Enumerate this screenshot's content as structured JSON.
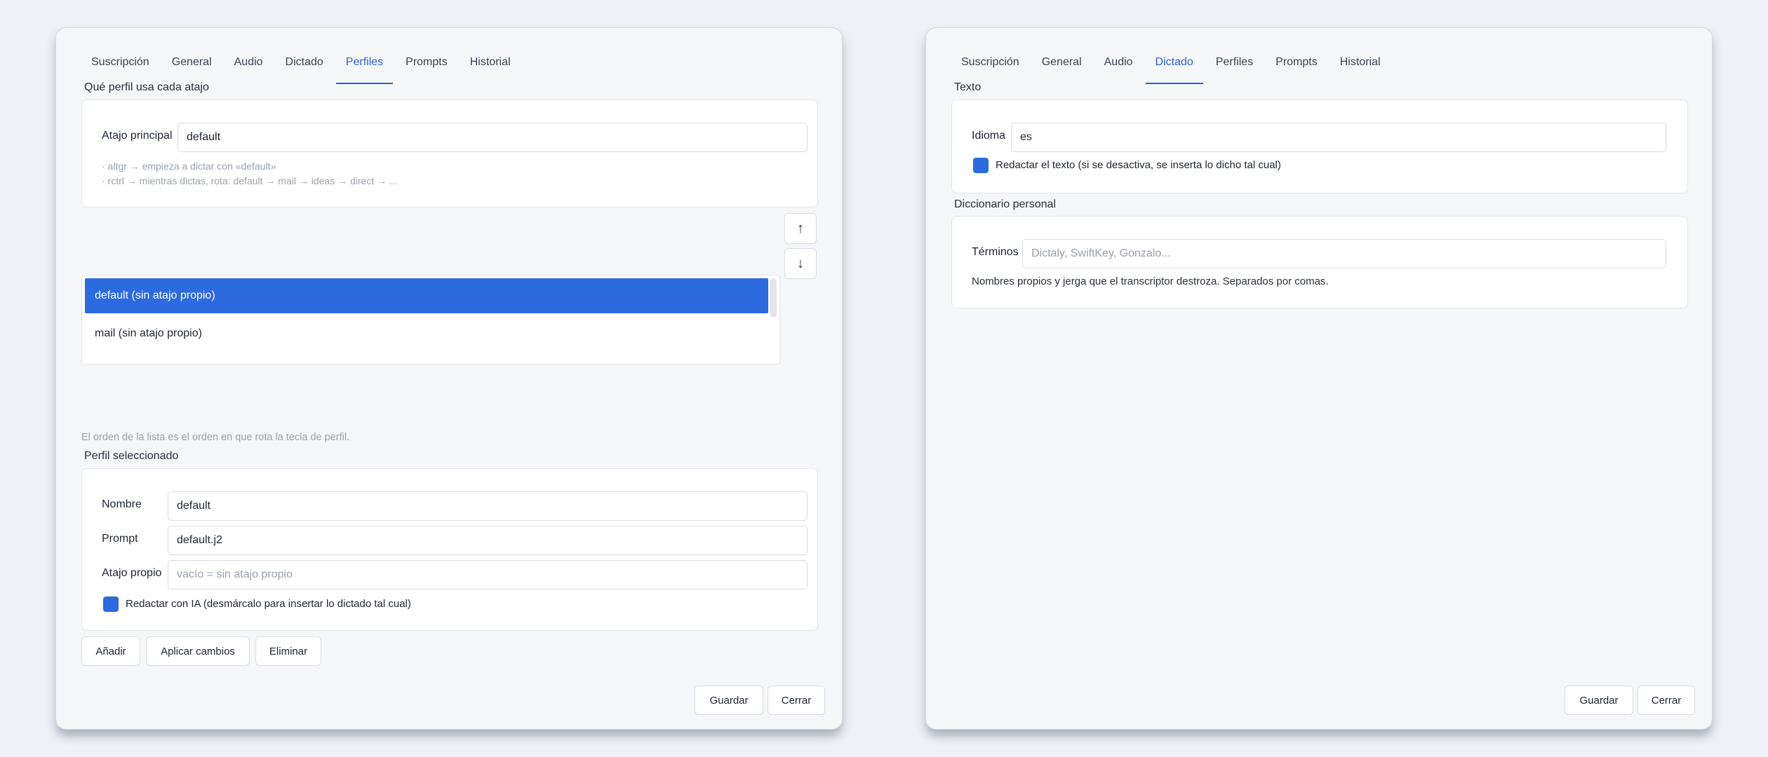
{
  "tabs": [
    "Suscripción",
    "General",
    "Audio",
    "Dictado",
    "Perfiles",
    "Prompts",
    "Historial"
  ],
  "left": {
    "active_tab": "Perfiles",
    "shortcut_section": {
      "title": "Qué perfil usa cada atajo",
      "main_shortcut_label": "Atajo principal",
      "main_shortcut_value": "default",
      "hint_lines": [
        "· altgr → empieza a dictar con «default»",
        "· rctrl → mientras dictas, rota: default → mail → ideas → direct → ..."
      ]
    },
    "move_up_icon": "↑",
    "move_down_icon": "↓",
    "profile_list": [
      {
        "label": "default  (sin atajo propio)",
        "selected": true
      },
      {
        "label": "mail  (sin atajo propio)",
        "selected": false
      }
    ],
    "order_hint": "El orden de la lista es el orden en que rota la tecla de perfil.",
    "selected_profile": {
      "title": "Perfil seleccionado",
      "name_label": "Nombre",
      "name_value": "default",
      "prompt_label": "Prompt",
      "prompt_value": "default.j2",
      "shortcut_label": "Atajo propio",
      "shortcut_placeholder": "vacío = sin atajo propio",
      "ai_checkbox_label": "Redactar con IA (desmárcalo para insertar lo dictado tal cual)"
    },
    "buttons": {
      "add": "Añadir",
      "apply": "Aplicar cambios",
      "delete": "Eliminar"
    },
    "footer": {
      "save": "Guardar",
      "close": "Cerrar"
    }
  },
  "right": {
    "active_tab": "Dictado",
    "text_section": {
      "title": "Texto",
      "language_label": "Idioma",
      "language_value": "es",
      "redact_label": "Redactar el texto (si se desactiva, se inserta lo dicho tal cual)"
    },
    "dictionary_section": {
      "title": "Diccionario personal",
      "terms_label": "Términos",
      "terms_placeholder": "Dictaly, SwiftKey, Gonzalo...",
      "hint": "Nombres propios y jerga que el transcriptor destroza. Separados por comas."
    },
    "footer": {
      "save": "Guardar",
      "close": "Cerrar"
    }
  },
  "colors": {
    "accent": "#2a62d6",
    "selection": "#2c6ae0",
    "background": "#eef1f7"
  }
}
